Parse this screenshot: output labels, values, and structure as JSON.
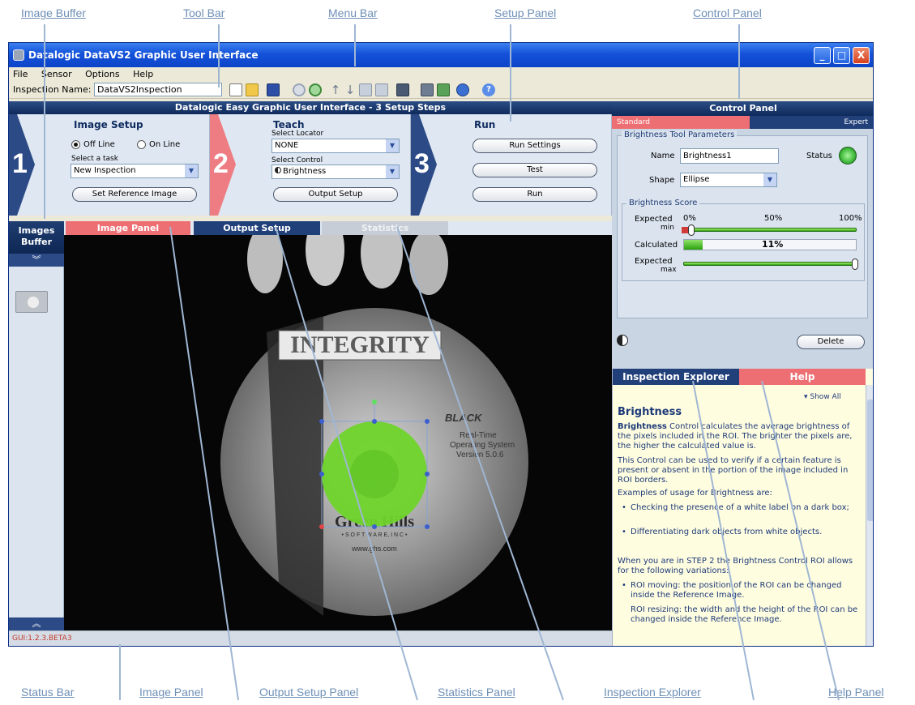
{
  "callouts": {
    "image_buffer": "Image Buffer",
    "tool_bar": "Tool Bar",
    "menu_bar": "Menu Bar",
    "setup_panel": "Setup Panel",
    "control_panel": "Control Panel",
    "status_bar": "Status Bar",
    "image_panel": "Image Panel",
    "output_setup_panel": "Output Setup Panel",
    "statistics_panel": "Statistics Panel",
    "inspection_explorer": "Inspection Explorer",
    "help_panel": "Help Panel"
  },
  "window": {
    "title": "Datalogic DataVS2 Graphic User Interface",
    "buttons": {
      "minimize": "_",
      "maximize": "□",
      "close": "X"
    }
  },
  "menu": [
    "File",
    "Sensor",
    "Options",
    "Help"
  ],
  "toolbar": {
    "inspection_label": "Inspection Name:",
    "inspection_value": "DataVS2Inspection",
    "icons": [
      "new-icon",
      "open-icon",
      "save-icon",
      "zoom-out-icon",
      "zoom-in-icon",
      "arrow-up-icon",
      "arrow-down-icon",
      "align-left-icon",
      "align-right-icon",
      "sensor-icon",
      "camera-icon",
      "picture-icon",
      "connect-icon",
      "help-icon"
    ]
  },
  "setup": {
    "heading": "Datalogic Easy Graphic User Interface - 3 Setup Steps",
    "step1": {
      "num": "1",
      "title": "Image Setup",
      "offline": "Off Line",
      "online": "On Line",
      "task_label": "Select a task",
      "task_value": "New Inspection",
      "button": "Set Reference Image"
    },
    "step2": {
      "num": "2",
      "title": "Teach",
      "locator_label": "Select Locator",
      "locator_value": "NONE",
      "control_label": "Select Control",
      "control_value": "Brightness",
      "button": "Output Setup"
    },
    "step3": {
      "num": "3",
      "title": "Run",
      "btn_settings": "Run Settings",
      "btn_test": "Test",
      "btn_run": "Run"
    }
  },
  "images_buffer": {
    "line1": "Images",
    "line2": "Buffer"
  },
  "tabs": {
    "image_panel": "Image Panel",
    "output_setup": "Output Setup",
    "statistics": "Statistics"
  },
  "status": {
    "text": "GUI:1.2.3.BETA3"
  },
  "disc": {
    "title": "INTEGRITY",
    "right1": "Real-Time",
    "right2": "Operating System",
    "right3": "Version 5.0.6",
    "company": "Green Hills",
    "company2": "• S O F T W A R E,  I N C •",
    "url": "www.ghs.com",
    "logo": "BLACK"
  },
  "control_panel": {
    "title": "Control Panel",
    "tab_standard": "Standard",
    "tab_expert": "Expert",
    "params_legend": "Brightness Tool Parameters",
    "name_label": "Name",
    "name_value": "Brightness1",
    "status_label": "Status",
    "shape_label": "Shape",
    "shape_value": "Ellipse",
    "score_legend": "Brightness Score",
    "expected_label": "Expected",
    "min_label": "min",
    "max_label": "max",
    "calculated_label": "Calculated",
    "pct0": "0%",
    "pct50": "50%",
    "pct100": "100%",
    "calculated_value": "11%",
    "calculated_fraction": 0.11,
    "delete": "Delete",
    "status_color": "#3fb93a"
  },
  "inspection_explorer": {
    "tab_explorer": "Inspection Explorer",
    "tab_help": "Help",
    "show_all": "Show All",
    "heading": "Brightness",
    "p1_bold": "Brightness",
    "p1": " Control calculates the average brightness of the pixels included in the ROI. The brighter the pixels are, the higher the calculated value is.",
    "p2": "This Control can be used to verify if a certain feature is present or absent in the portion of the image included in ROI borders.",
    "p3": "Examples of usage for Brightness are:",
    "b1": "Checking the presence of a white label on a dark box;",
    "b2": "Differentiating dark objects from white objects.",
    "p4": "When you are in STEP 2 the Brightness Control ROI allows for the following variations:",
    "b3": "ROI moving: the position of the ROI can be changed inside the Reference Image.",
    "b4": "ROI resizing: the width and the height of the ROI can be changed inside the Reference Image."
  }
}
